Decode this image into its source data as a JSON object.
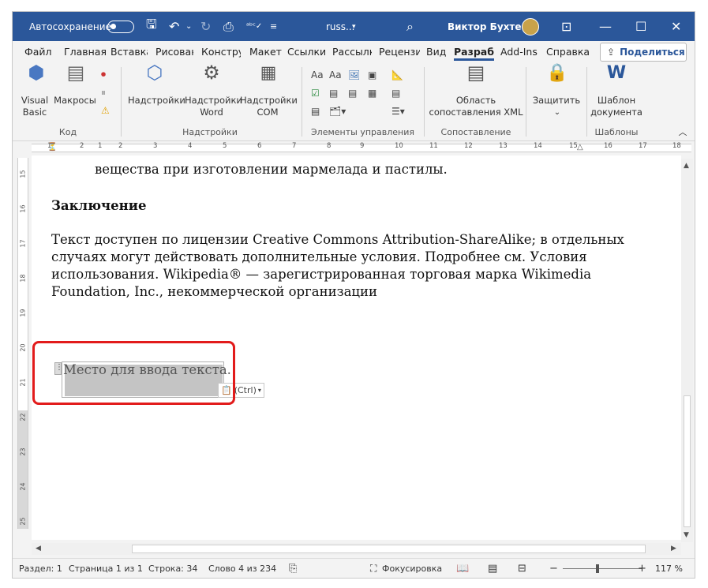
{
  "titlebar": {
    "autosave_label": "Автосохранение",
    "doc_name": "russ...",
    "user_name": "Виктор Бухтеев",
    "icons": [
      "save-icon",
      "undo-icon",
      "undo-dropdown-icon",
      "redo-icon",
      "touch-mode-icon",
      "spelling-icon",
      "qat-dropdown-icon",
      "search-icon",
      "ribbon-display-icon",
      "minimize-icon",
      "maximize-icon",
      "close-icon"
    ]
  },
  "tabs": [
    "Файл",
    "Главная",
    "Вставка",
    "Рисован",
    "Констру",
    "Макет",
    "Ссылки",
    "Рассылк",
    "Рецензи",
    "Вид",
    "Разрабо",
    "Add-Ins",
    "Справка"
  ],
  "active_tab": "Разрабо",
  "share_label": "Поделиться",
  "ribbon": {
    "visual_basic": "Visual Basic",
    "macros": "Макросы",
    "addins": "Надстройки",
    "word_addins": "Надстройки Word",
    "com_addins": "Надстройки COM",
    "xml_mapping": "Область сопоставления XML",
    "protect": "Защитить",
    "doc_template": "Шаблон документа",
    "groups": {
      "code": "Код",
      "addins": "Надстройки",
      "controls": "Элементы управления",
      "mapping": "Сопоставление",
      "templates": "Шаблоны"
    }
  },
  "ruler_numbers": [
    "2",
    "1",
    "1",
    "2",
    "3",
    "4",
    "5",
    "6",
    "7",
    "8",
    "9",
    "10",
    "11",
    "12",
    "13",
    "14",
    "15",
    "16",
    "17",
    "18"
  ],
  "vruler_numbers": [
    "15",
    "16",
    "17",
    "18",
    "19",
    "20",
    "21",
    "22",
    "23",
    "24",
    "25"
  ],
  "document": {
    "line_top": "вещества при изготовлении мармелада и пастилы.",
    "heading": "Заключение",
    "para": [
      "Текст доступен по лицензии Creative Commons Attribution-ShareAlike; в отдельных",
      "случаях могут действовать дополнительные условия. Подробнее см. Условия",
      "использования. Wikipedia® — зарегистрированная торговая марка Wikimedia",
      "Foundation, Inc., некоммерческой организации"
    ],
    "content_control_placeholder": "Место для ввода текста.",
    "paste_options": "(Ctrl)"
  },
  "status": {
    "section": "Раздел: 1",
    "page": "Страница 1 из 1",
    "line": "Строка: 34",
    "word": "Слово 4 из 234",
    "focus": "Фокусировка",
    "zoom": "117 %",
    "zoom_minus": "−",
    "zoom_plus": "+"
  },
  "colors": {
    "titlebar": "#2b579a",
    "highlight": "#e21b1b"
  }
}
